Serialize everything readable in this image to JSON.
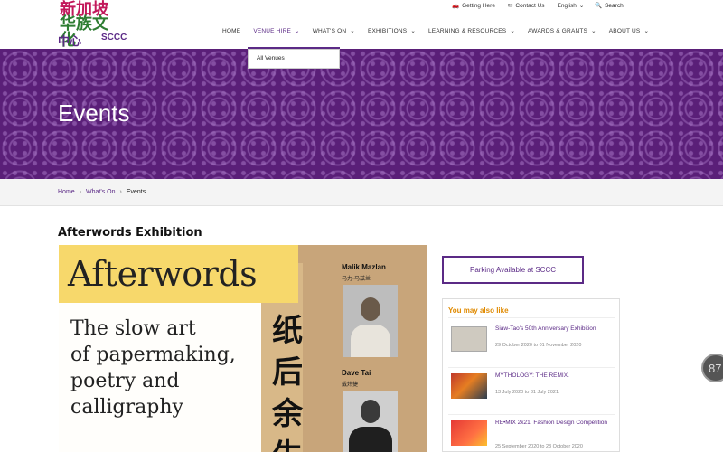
{
  "logo": {
    "line1": "新加坡",
    "line2": "华族文化",
    "line3": "中心",
    "abbr": "SCCC"
  },
  "utility": {
    "getting_here": "Getting Here",
    "contact_us": "Contact Us",
    "language": "English",
    "search": "Search"
  },
  "nav": {
    "items": [
      {
        "label": "HOME"
      },
      {
        "label": "VENUE HIRE",
        "active": true
      },
      {
        "label": "WHAT'S ON"
      },
      {
        "label": "EXHIBITIONS"
      },
      {
        "label": "LEARNING & RESOURCES"
      },
      {
        "label": "AWARDS & GRANTS"
      },
      {
        "label": "ABOUT US"
      }
    ]
  },
  "dropdown": {
    "item": "All Venues"
  },
  "hero": {
    "title": "Events"
  },
  "breadcrumb": {
    "home": "Home",
    "whats_on": "What's On",
    "current": "Events"
  },
  "main": {
    "title": "Afterwords Exhibition"
  },
  "poster": {
    "title": "Afterwords",
    "subtitle": [
      "The slow art",
      "of papermaking,",
      "poetry and",
      "calligraphy"
    ],
    "cjk": [
      "纸",
      "后",
      "余",
      "生"
    ],
    "artist1": "Malik Mazlan",
    "artist1_cjk": "马力·马兹兰",
    "artist2": "Dave Tai",
    "artist2_cjk": "戴炜捷"
  },
  "sidebar": {
    "parking": "Parking Available at SCCC",
    "also_like": "You may also like",
    "related": [
      {
        "title": "Siaw-Tao's 50th Anniversary Exhibition",
        "date": "29 October 2020 to 01 November 2020"
      },
      {
        "title": "MYTHOLOGY: THE REMIX.",
        "date": "13 July 2020 to 31 July 2021"
      },
      {
        "title": "RE•MIX 2k21: Fashion Design Competition",
        "date": "25 September 2020 to 23 October 2020"
      }
    ]
  },
  "fab": {
    "label": "87"
  },
  "colors": {
    "brand": "#5b2a86",
    "accent": "#e08a00"
  }
}
